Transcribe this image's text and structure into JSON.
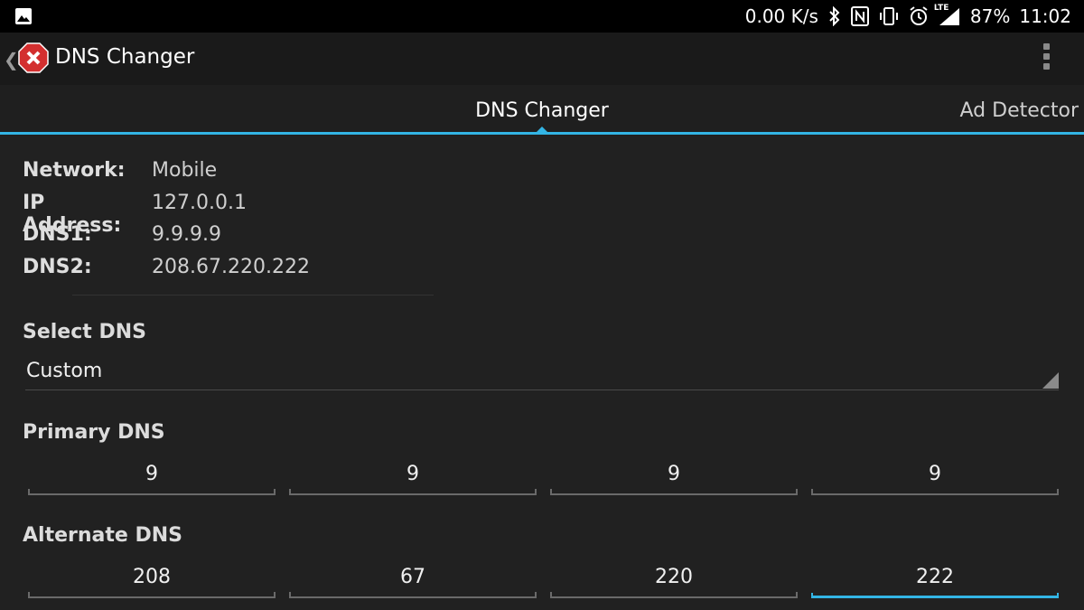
{
  "status_bar": {
    "speed": "0.00 K/s",
    "network_badge": "LTE",
    "battery": "87%",
    "time": "11:02",
    "icons": [
      "image-notification-icon",
      "bluetooth-icon",
      "nfc-icon",
      "vibrate-icon",
      "alarm-icon",
      "signal-icon"
    ]
  },
  "action_bar": {
    "title": "DNS Changer",
    "app_icon": "red-x-shield-icon",
    "overflow": "overflow-menu-icon"
  },
  "tabs": [
    {
      "label": "DNS Changer",
      "active": true
    },
    {
      "label": "Ad Detector",
      "active": false
    }
  ],
  "info": {
    "rows": [
      {
        "label": "Network:",
        "value": "Mobile"
      },
      {
        "label": "IP Address:",
        "value": "127.0.0.1"
      },
      {
        "label": "DNS1:",
        "value": "9.9.9.9"
      },
      {
        "label": "DNS2:",
        "value": "208.67.220.222"
      }
    ]
  },
  "select_dns": {
    "label": "Select DNS",
    "value": "Custom"
  },
  "primary_dns": {
    "label": "Primary DNS",
    "octets": [
      "9",
      "9",
      "9",
      "9"
    ]
  },
  "alternate_dns": {
    "label": "Alternate DNS",
    "octets": [
      "208",
      "67",
      "220",
      "222"
    ],
    "focused_index": 3
  },
  "colors": {
    "accent": "#33b5e5",
    "background": "#212121",
    "status_bar": "#000000",
    "app_icon_red": "#d32f2f"
  }
}
